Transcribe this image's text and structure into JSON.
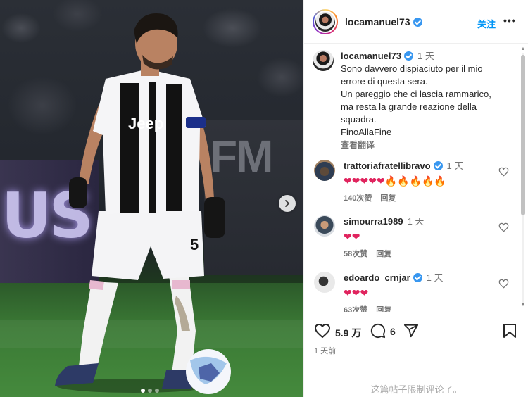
{
  "post": {
    "username": "locamanuel73",
    "follow_label": "关注",
    "more_label": "•••",
    "caption": {
      "username": "locamanuel73",
      "time": "1 天",
      "lines": [
        "Sono davvero dispiaciuto per il mio",
        "errore di questa sera.",
        "Un pareggio che ci lascia rammarico,",
        "ma resta la grande reazione della",
        "squadra.",
        "FinoAllaFine"
      ],
      "translate_label": "查看翻译"
    },
    "comments": [
      {
        "username": "trattoriafratellibravo",
        "verified": true,
        "time": "1 天",
        "emojis": "❤❤❤❤❤🔥🔥🔥🔥🔥",
        "likes": "140次赞",
        "reply_label": "回复"
      },
      {
        "username": "simourra1989",
        "verified": false,
        "time": "1 天",
        "emojis": "❤❤",
        "likes": "58次赞",
        "reply_label": "回复"
      },
      {
        "username": "edoardo_crnjar",
        "verified": true,
        "time": "1 天",
        "emojis": "❤❤❤",
        "likes": "63次赞",
        "reply_label": "回复"
      }
    ],
    "likes_count": "5.9 万",
    "comments_count": "6",
    "posted_time": "1 天前",
    "comments_restricted": "这篇帖子限制评论了。"
  },
  "media": {
    "jersey_sponsor": "Jeep",
    "jersey_number": "5",
    "carousel_dots": 3,
    "active_dot": 0
  },
  "icons": {
    "like": "heart-icon",
    "comment": "comment-icon",
    "share": "send-icon",
    "save": "bookmark-icon",
    "next": "chevron-right-icon",
    "verified": "verified-badge-icon"
  },
  "colors": {
    "accent": "#0095f6",
    "verified": "#3897f0",
    "heart_emoji": "#e0245e",
    "fire_emoji": "#ff7a00"
  }
}
